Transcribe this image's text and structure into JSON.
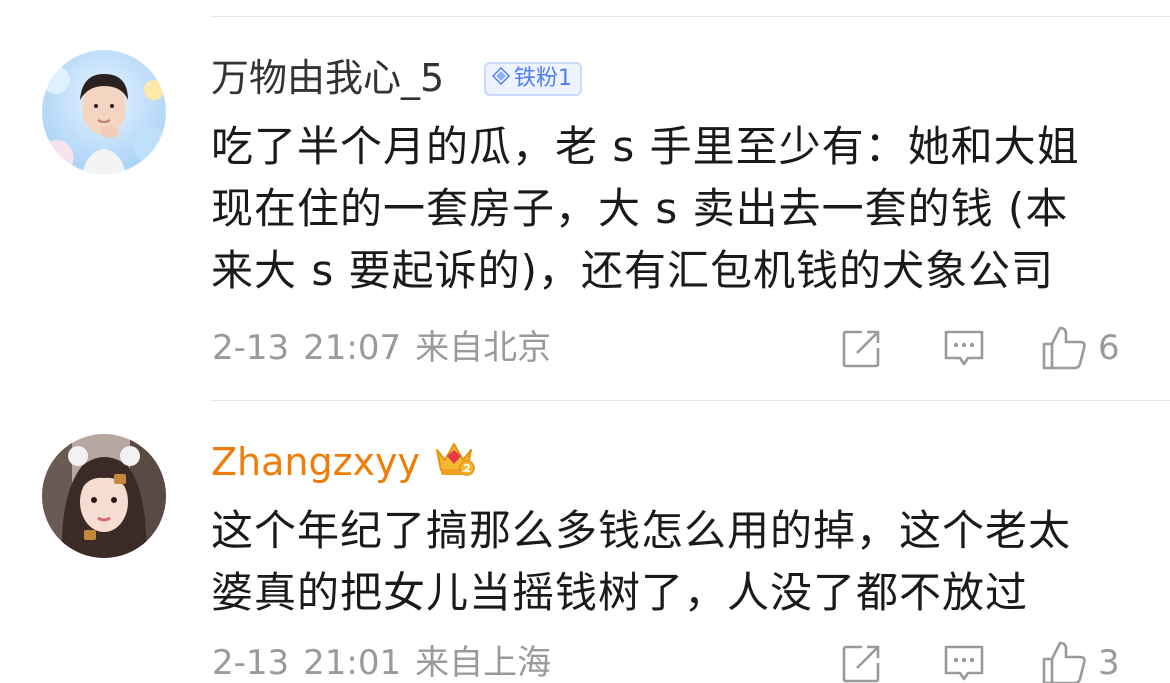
{
  "comments": [
    {
      "username": "万物由我心_5",
      "badge": "铁粉1",
      "text_lines": [
        "吃了半个月的瓜，老 s 手里至少有：她和大姐",
        "现在住的一套房子，大 s 卖出去一套的钱 (本",
        "来大 s 要起诉的)，还有汇包机钱的犬象公司"
      ],
      "date": "2-13",
      "time": "21:07",
      "location": "来自北京",
      "like_count": "6",
      "icons": [
        "share-icon",
        "comment-icon",
        "like-icon"
      ]
    },
    {
      "username": "Zhangzxyy",
      "badge_icon": "crown-icon",
      "text_lines": [
        "这个年纪了搞那么多钱怎么用的掉，这个老太",
        "婆真的把女儿当摇钱树了，人没了都不放过"
      ],
      "date": "2-13",
      "time": "21:01",
      "location": "来自上海",
      "like_count": "3",
      "icons": [
        "share-icon",
        "comment-icon",
        "like-icon"
      ]
    }
  ],
  "colors": {
    "username_gray": "#333333",
    "username_vip": "#f07c0a",
    "badge_blue": "#4f7ef3",
    "meta_gray": "#9a9a9a"
  }
}
